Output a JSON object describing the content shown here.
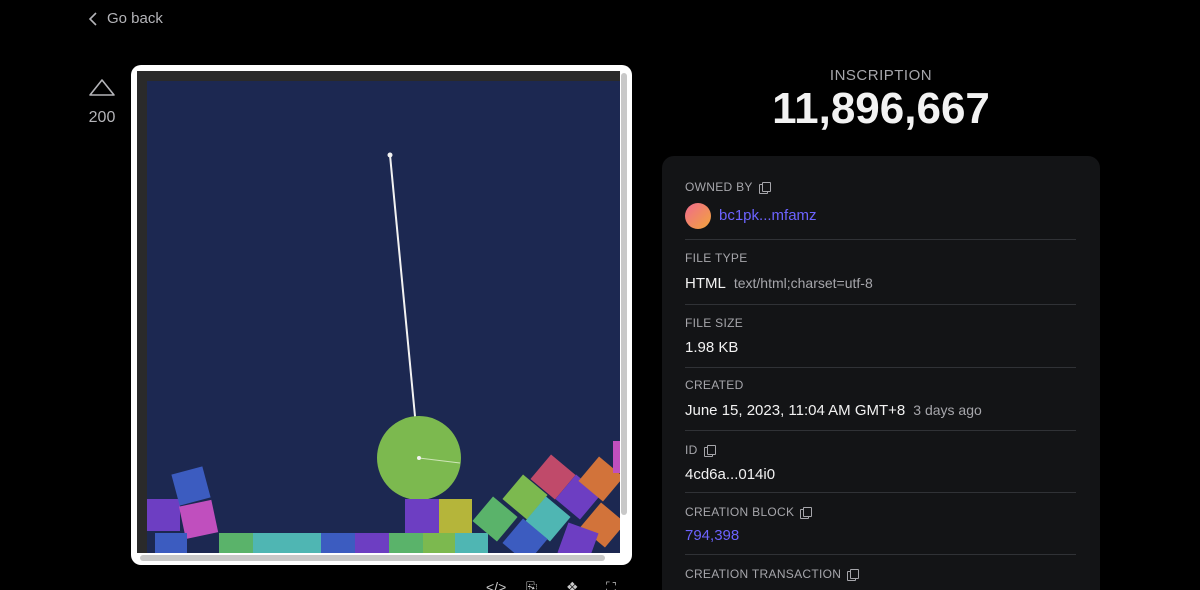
{
  "nav": {
    "back_label": "Go back"
  },
  "vote": {
    "count": "200"
  },
  "inscription": {
    "label": "INSCRIPTION",
    "number": "11,896,667"
  },
  "details": {
    "owned_by": {
      "label": "OWNED BY",
      "value": "bc1pk...mfamz"
    },
    "file_type": {
      "label": "FILE TYPE",
      "value": "HTML",
      "sub": "text/html;charset=utf-8"
    },
    "file_size": {
      "label": "FILE SIZE",
      "value": "1.98 KB"
    },
    "created": {
      "label": "CREATED",
      "value": "June 15, 2023, 11:04 AM GMT+8",
      "sub": "3 days ago"
    },
    "id": {
      "label": "ID",
      "value": "4cd6a...014i0"
    },
    "creation_block": {
      "label": "CREATION BLOCK",
      "value": "794,398"
    },
    "creation_transaction": {
      "label": "CREATION TRANSACTION"
    }
  },
  "toolbar": {
    "icons": [
      "code-icon",
      "copy-icon",
      "twitter-icon",
      "fullscreen-icon"
    ]
  },
  "colors": {
    "accent": "#6c63ff",
    "panel": "#131416",
    "scene_background": "#1c2851",
    "pendulum_ball": "#7cb94f"
  }
}
